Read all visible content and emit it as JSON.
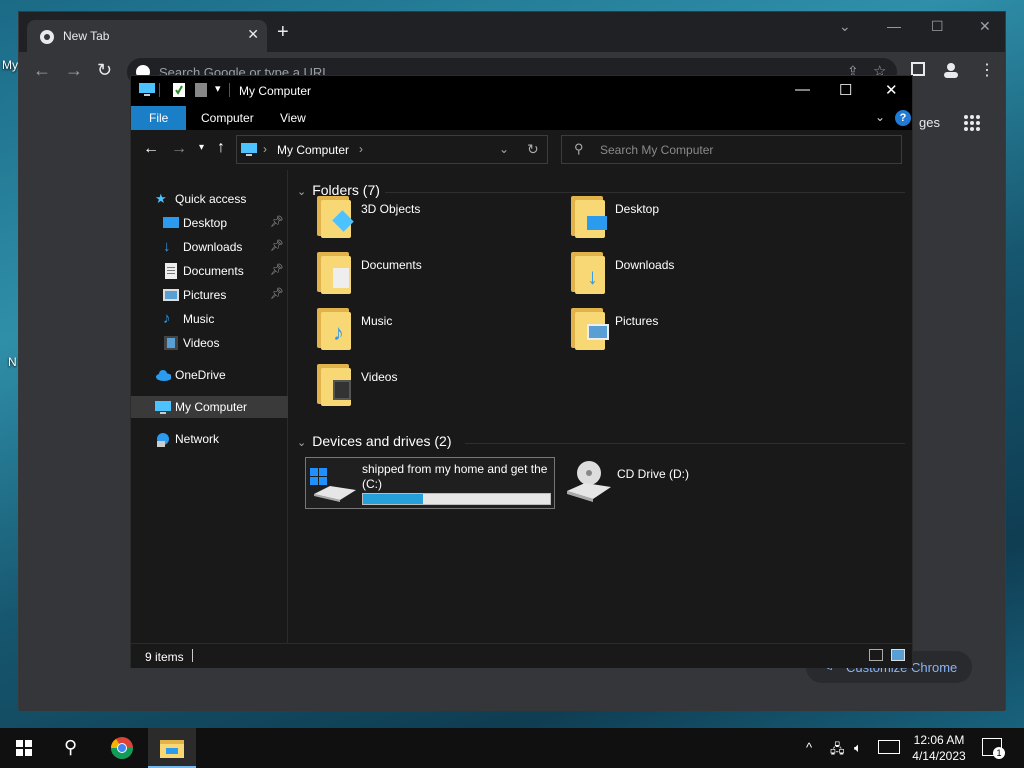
{
  "desktop": {
    "left_label_1": "My",
    "left_label_2": "N"
  },
  "chrome": {
    "tab_title": "New Tab",
    "tab_close": "✕",
    "new_tab": "+",
    "omnibox_placeholder": "Search Google or type a URL",
    "apps_partial_label": "ges",
    "customize_label": "Customize Chrome"
  },
  "explorer": {
    "title": "My Computer",
    "ribbon_tabs": [
      "File",
      "Computer",
      "View"
    ],
    "address_text": "My Computer",
    "search_placeholder": "Search My Computer",
    "nav": {
      "quick_access": "Quick access",
      "desktop": "Desktop",
      "downloads": "Downloads",
      "documents": "Documents",
      "pictures": "Pictures",
      "music": "Music",
      "videos": "Videos",
      "onedrive": "OneDrive",
      "my_computer": "My Computer",
      "network": "Network"
    },
    "folders_header": "Folders (7)",
    "folders": [
      "3D Objects",
      "Desktop",
      "Documents",
      "Downloads",
      "Music",
      "Pictures",
      "Videos"
    ],
    "devices_header": "Devices and drives (2)",
    "drive_c_label": "shipped from my home and get the (C:)",
    "drive_c_used_fraction": 0.32,
    "drive_d_label": "CD Drive (D:)",
    "status_items": "9 items",
    "accent": "#1b7fc7"
  },
  "taskbar": {
    "time": "12:06 AM",
    "date": "4/14/2023",
    "notification_count": "1"
  }
}
